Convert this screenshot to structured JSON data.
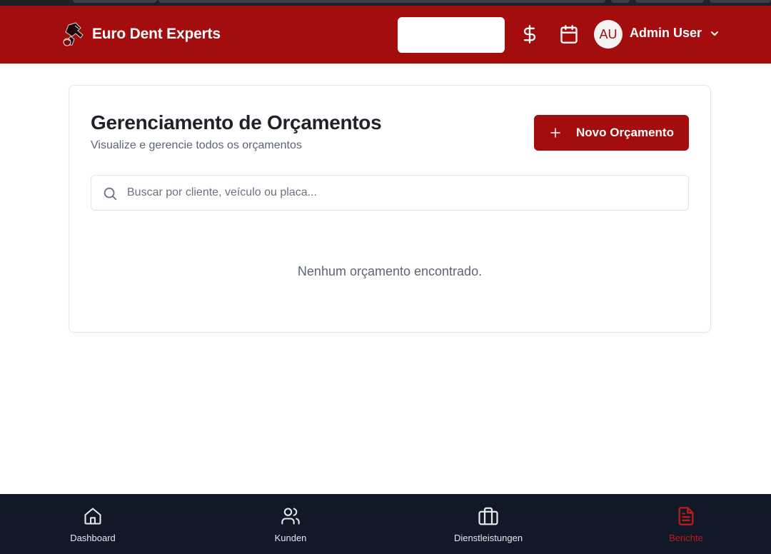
{
  "header": {
    "brand_title": "Euro Dent Experts",
    "search_value": "",
    "avatar_initials": "AU",
    "user_name": "Admin User",
    "icons": [
      "dollar-icon",
      "calendar-icon",
      "chevron-down-icon"
    ]
  },
  "main": {
    "title": "Gerenciamento de Orçamentos",
    "subtitle": "Visualize e gerencie todos os orçamentos",
    "new_button_label": "Novo Orçamento",
    "search_placeholder": "Buscar por cliente, veículo ou placa...",
    "empty_message": "Nenhum orçamento encontrado."
  },
  "bottom_nav": {
    "items": [
      {
        "label": "Dashboard",
        "icon": "home-icon",
        "active": false
      },
      {
        "label": "Kunden",
        "icon": "users-icon",
        "active": false
      },
      {
        "label": "Dienstleistungen",
        "icon": "briefcase-icon",
        "active": false
      },
      {
        "label": "Berichte",
        "icon": "document-icon",
        "active": true
      }
    ]
  },
  "colors": {
    "brand_red": "#a30d0d",
    "nav_background": "#111827",
    "active_nav": "#b91c1c"
  }
}
